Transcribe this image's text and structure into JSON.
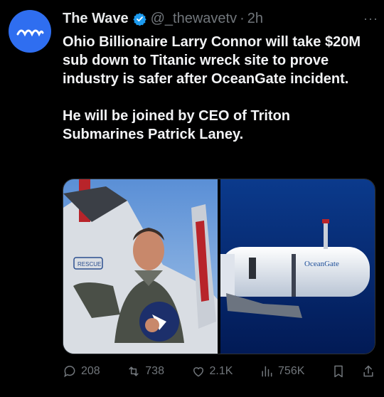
{
  "tweet": {
    "display_name": "The Wave",
    "handle": "@_thewavetv",
    "separator": "·",
    "time": "2h",
    "more": "···",
    "text": "Ohio Billionaire Larry Connor will take $20M sub down to Titanic wreck site to prove industry is safer after OceanGate incident.\n\nHe will be joined by CEO of Triton Submarines Patrick Laney.",
    "colors": {
      "background": "#000000",
      "text": "#e7e9ea",
      "muted": "#71767b",
      "verified": "#1d9bf0",
      "avatar": "#2f6ef0"
    },
    "media": {
      "left_label": "RESCUE",
      "right_label": "OceanGate"
    },
    "actions": {
      "replies": "208",
      "retweets": "738",
      "likes": "2.1K",
      "views": "756K"
    }
  }
}
